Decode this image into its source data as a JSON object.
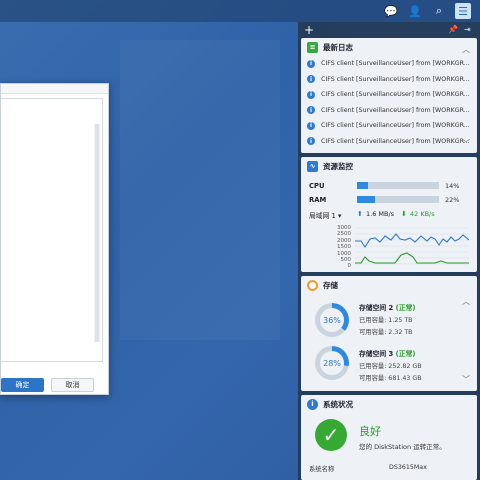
{
  "taskbar": {
    "icons": [
      "chat-icon",
      "user-icon",
      "search-icon",
      "widgets-icon"
    ]
  },
  "dialog": {
    "ok_label": "确定",
    "cancel_label": "取消"
  },
  "panel": {
    "add_icon": "+"
  },
  "log_widget": {
    "title": "最新日志",
    "entries": [
      "CIFS client [SurveillanceUser] from [WORKGR...",
      "CIFS client [SurveillanceUser] from [WORKGR...",
      "CIFS client [SurveillanceUser] from [WORKGR...",
      "CIFS client [SurveillanceUser] from [WORKGR...",
      "CIFS client [SurveillanceUser] from [WORKGR...",
      "CIFS client [SurveillanceUser] from [WORKGR..."
    ]
  },
  "resource_widget": {
    "title": "资源监控",
    "cpu_label": "CPU",
    "cpu_pct": "14%",
    "cpu_value": 14,
    "ram_label": "RAM",
    "ram_pct": "22%",
    "ram_value": 22,
    "net_label": "局域网 1 ▾",
    "upload": "1.6 MB/s",
    "download": "42 KB/s",
    "y_ticks": [
      "3000",
      "2500",
      "2000",
      "1500",
      "1000",
      "500",
      "0"
    ]
  },
  "storage_widget": {
    "title": "存储",
    "volumes": [
      {
        "name": "存储空间 2",
        "status": "(正常)",
        "pct": "36%",
        "value": 36,
        "used": "已用容量: 1.25 TB",
        "free": "可用容量: 2.32 TB"
      },
      {
        "name": "存储空间 3",
        "status": "(正常)",
        "pct": "28%",
        "value": 28,
        "used": "已用容量: 252.82 GB",
        "free": "可用容量: 681.43 GB"
      }
    ]
  },
  "status_widget": {
    "title": "系统状况",
    "state": "良好",
    "message": "您的 DiskStation 运转正常。",
    "model_label": "系统名称",
    "model_value": "DS3615Max"
  },
  "colors": {
    "accent": "#2d74c7",
    "ok_green": "#36a935",
    "up_arrow": "#2d7ad0",
    "down_arrow": "#2a9a2a"
  }
}
